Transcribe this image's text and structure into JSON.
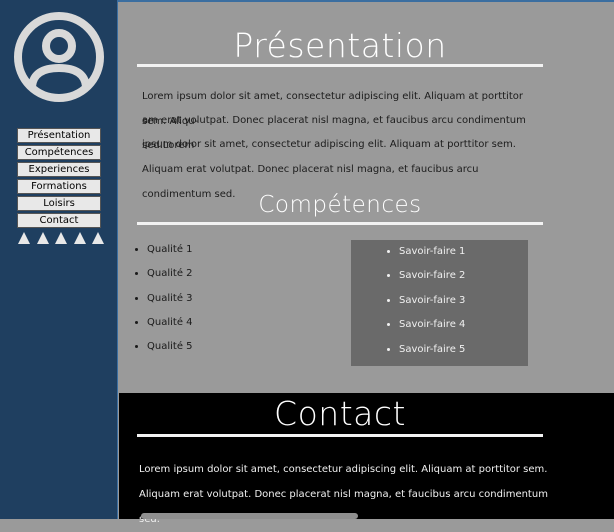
{
  "sidebar": {
    "avatar_icon": "user-circle-icon",
    "nav": [
      {
        "label": "Présentation"
      },
      {
        "label": "Compétences"
      },
      {
        "label": "Experiences"
      },
      {
        "label": "Formations"
      },
      {
        "label": "Loisirs"
      },
      {
        "label": "Contact"
      }
    ],
    "decoration_icons": [
      "triangle-icon",
      "triangle-icon",
      "triangle-icon",
      "triangle-icon",
      "triangle-icon"
    ]
  },
  "presentation": {
    "title": "Présentation",
    "lines": [
      "Lorem ipsum dolor sit amet, consectetur adipiscing elit. Aliquam at porttitor sem.  Aliqu-",
      "am erat volutpat. Donec placerat nisl magna, et faucibus arcu condimentum sed.Lorem",
      "ipsum dolor sit amet, consectetur adipiscing elit. Aliquam at porttitor sem.",
      "Aliquam erat volutpat. Donec placerat nisl magna, et faucibus arcu condimentum sed."
    ]
  },
  "competences": {
    "title": "Compétences",
    "qualites": [
      "Qualité 1",
      "Qualité 2",
      "Qualité 3",
      "Qualité 4",
      "Qualité 5"
    ],
    "savoirs": [
      "Savoir-faire 1",
      "Savoir-faire 2",
      "Savoir-faire 3",
      "Savoir-faire 4",
      "Savoir-faire 5"
    ]
  },
  "contact": {
    "title": "Contact",
    "lines": [
      "Lorem ipsum dolor sit amet, consectetur adipiscing elit. Aliquam at porttitor sem.",
      "Aliquam erat volutpat. Donec placerat nisl magna, et faucibus arcu condimentum sed."
    ]
  },
  "colors": {
    "sidebar_bg": "#1f3f60",
    "content_bg": "#9a9a9a",
    "skills_box_bg": "#6a6a6a",
    "contact_bg": "#000000"
  }
}
